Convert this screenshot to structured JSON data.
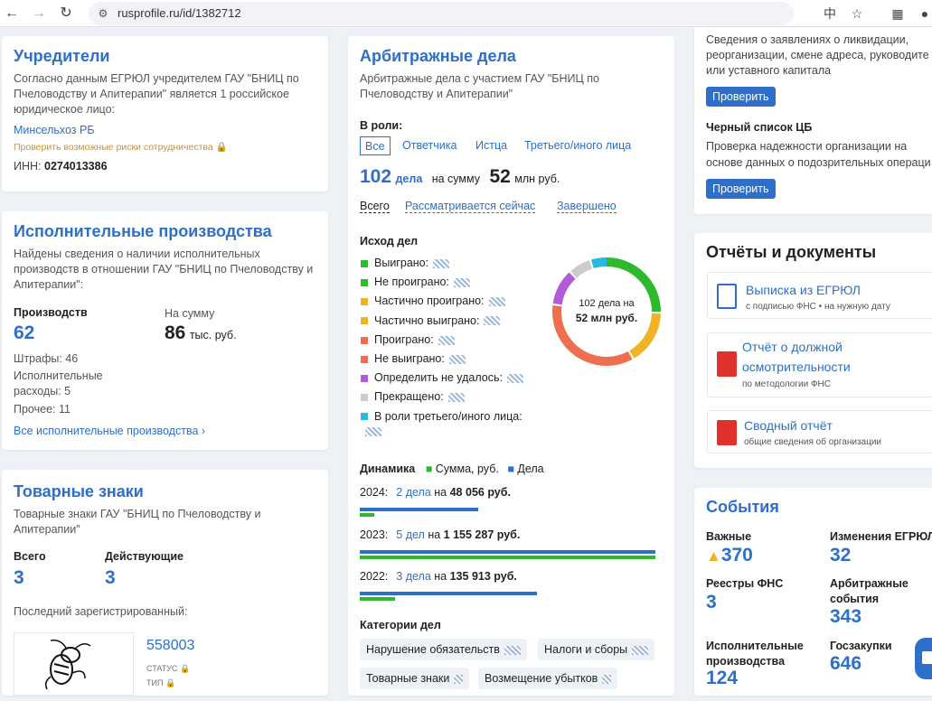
{
  "browser": {
    "url": "rusprofile.ru/id/1382712"
  },
  "founders": {
    "title": "Учредители",
    "description": "Согласно данным ЕГРЮЛ учредителем ГАУ \"БНИЦ по Пчеловодству и Апитерапии\" является 1 российское юридическое лицо:",
    "founder_name": "Минсельхоз РБ",
    "risk_text": "Проверить возможные риски сотрудничества",
    "inn_label": "ИНН:",
    "inn_value": "0274013386"
  },
  "enforcement": {
    "title": "Исполнительные производства",
    "description": "Найдены сведения о наличии исполнительных производств в отношении ГАУ \"БНИЦ по Пчеловодству и Апитерапии\":",
    "count_label": "Производств",
    "count_value": "62",
    "sum_label": "На сумму",
    "sum_value": "86",
    "sum_unit": "тыс. руб.",
    "fines": "Штрафы: 46",
    "expenses_line1": "Исполнительные",
    "expenses_line2": "расходы: 5",
    "other": "Прочее: 11",
    "all_link": "Все исполнительные производства"
  },
  "trademarks": {
    "title": "Товарные знаки",
    "description": "Товарные знаки ГАУ \"БНИЦ по Пчеловодству и Апитерапии\"",
    "total_label": "Всего",
    "total_value": "3",
    "active_label": "Действующие",
    "active_value": "3",
    "last_label": "Последний зарегистрированный:",
    "last_number": "558003",
    "status_label": "СТАТУС",
    "type_label": "ТИП"
  },
  "arbitration": {
    "title": "Арбитражные дела",
    "description": "Арбитражные дела с участием ГАУ \"БНИЦ по Пчеловодству и Апитерапии\"",
    "role_label": "В роли:",
    "roles": [
      "Все",
      "Ответчика",
      "Истца",
      "Третьего/иного лица"
    ],
    "cases_count": "102",
    "cases_word": "дела",
    "sum_prefix": "на сумму",
    "sum_value": "52",
    "sum_unit": "млн руб.",
    "filters": [
      "Всего",
      "Рассматривается сейчас",
      "Завершено"
    ],
    "outcomes_label": "Исход дел",
    "outcomes": [
      {
        "label": "Выиграно:",
        "color": "#2eb82e"
      },
      {
        "label": "Не проиграно:",
        "color": "#2eb82e"
      },
      {
        "label": "Частично проиграно:",
        "color": "#f0b323"
      },
      {
        "label": "Частично выиграно:",
        "color": "#f0b323"
      },
      {
        "label": "Проиграно:",
        "color": "#ee6f4f"
      },
      {
        "label": "Не выиграно:",
        "color": "#ee6f4f"
      },
      {
        "label": "Определить не удалось:",
        "color": "#b25ad9"
      },
      {
        "label": "Прекращено:",
        "color": "#cccccc"
      },
      {
        "label": "В роли третьего/иного лица:",
        "color": "#2ab8e0"
      }
    ],
    "donut_line1": "102 дела на",
    "donut_line2": "52 млн руб.",
    "dynamics_label": "Динамика",
    "legend_sum": "Сумма, руб.",
    "legend_cases": "Дела",
    "years": [
      {
        "year": "2024:",
        "cases": "2 дела",
        "on": "на",
        "sum": "48 056 руб.",
        "cases_fraction": 0.4,
        "sum_fraction": 0.05
      },
      {
        "year": "2023:",
        "cases": "5 дел",
        "on": "на",
        "sum": "1 155 287 руб.",
        "cases_fraction": 1.0,
        "sum_fraction": 1.0
      },
      {
        "year": "2022:",
        "cases": "3 дела",
        "on": "на",
        "sum": "135 913 руб.",
        "cases_fraction": 0.6,
        "sum_fraction": 0.12
      }
    ],
    "categories_label": "Категории дел",
    "categories": [
      "Нарушение обязательств",
      "Налоги и сборы",
      "Товарные знаки",
      "Возмещение убытков"
    ]
  },
  "right_top": {
    "liquidation_text1": "Сведения о заявлениях о ликвидации,",
    "liquidation_text2": "реорганизации, смене адреса, руководите",
    "liquidation_text3": "или уставного капитала",
    "check_button": "Проверить",
    "blacklist_title": "Черный список ЦБ",
    "blacklist_text1": "Проверка надежности организации на",
    "blacklist_text2": "основе данных о подозрительных операци",
    "check_button2": "Проверить"
  },
  "reports": {
    "title": "Отчёты и документы",
    "items": [
      {
        "title": "Выписка из ЕГРЮЛ",
        "subtitle": "с подписью ФНС • на нужную дату"
      },
      {
        "title1": "Отчёт о должной",
        "title2": "осмотрительности",
        "subtitle": "по методологии ФНС"
      },
      {
        "title": "Сводный отчёт",
        "subtitle": "общие сведения об организации"
      }
    ]
  },
  "events": {
    "title": "События",
    "important_label": "Важные",
    "important_value": "370",
    "egrul_label": "Изменения ЕГРЮЛ",
    "egrul_value": "32",
    "fns_label": "Реестры ФНС",
    "fns_value": "3",
    "arb_label1": "Арбитражные",
    "arb_label2": "события",
    "arb_value": "343",
    "exec_label1": "Исполнительные",
    "exec_label2": "производства",
    "exec_value": "124",
    "gz_label": "Госзакупки",
    "gz_value": "646"
  }
}
